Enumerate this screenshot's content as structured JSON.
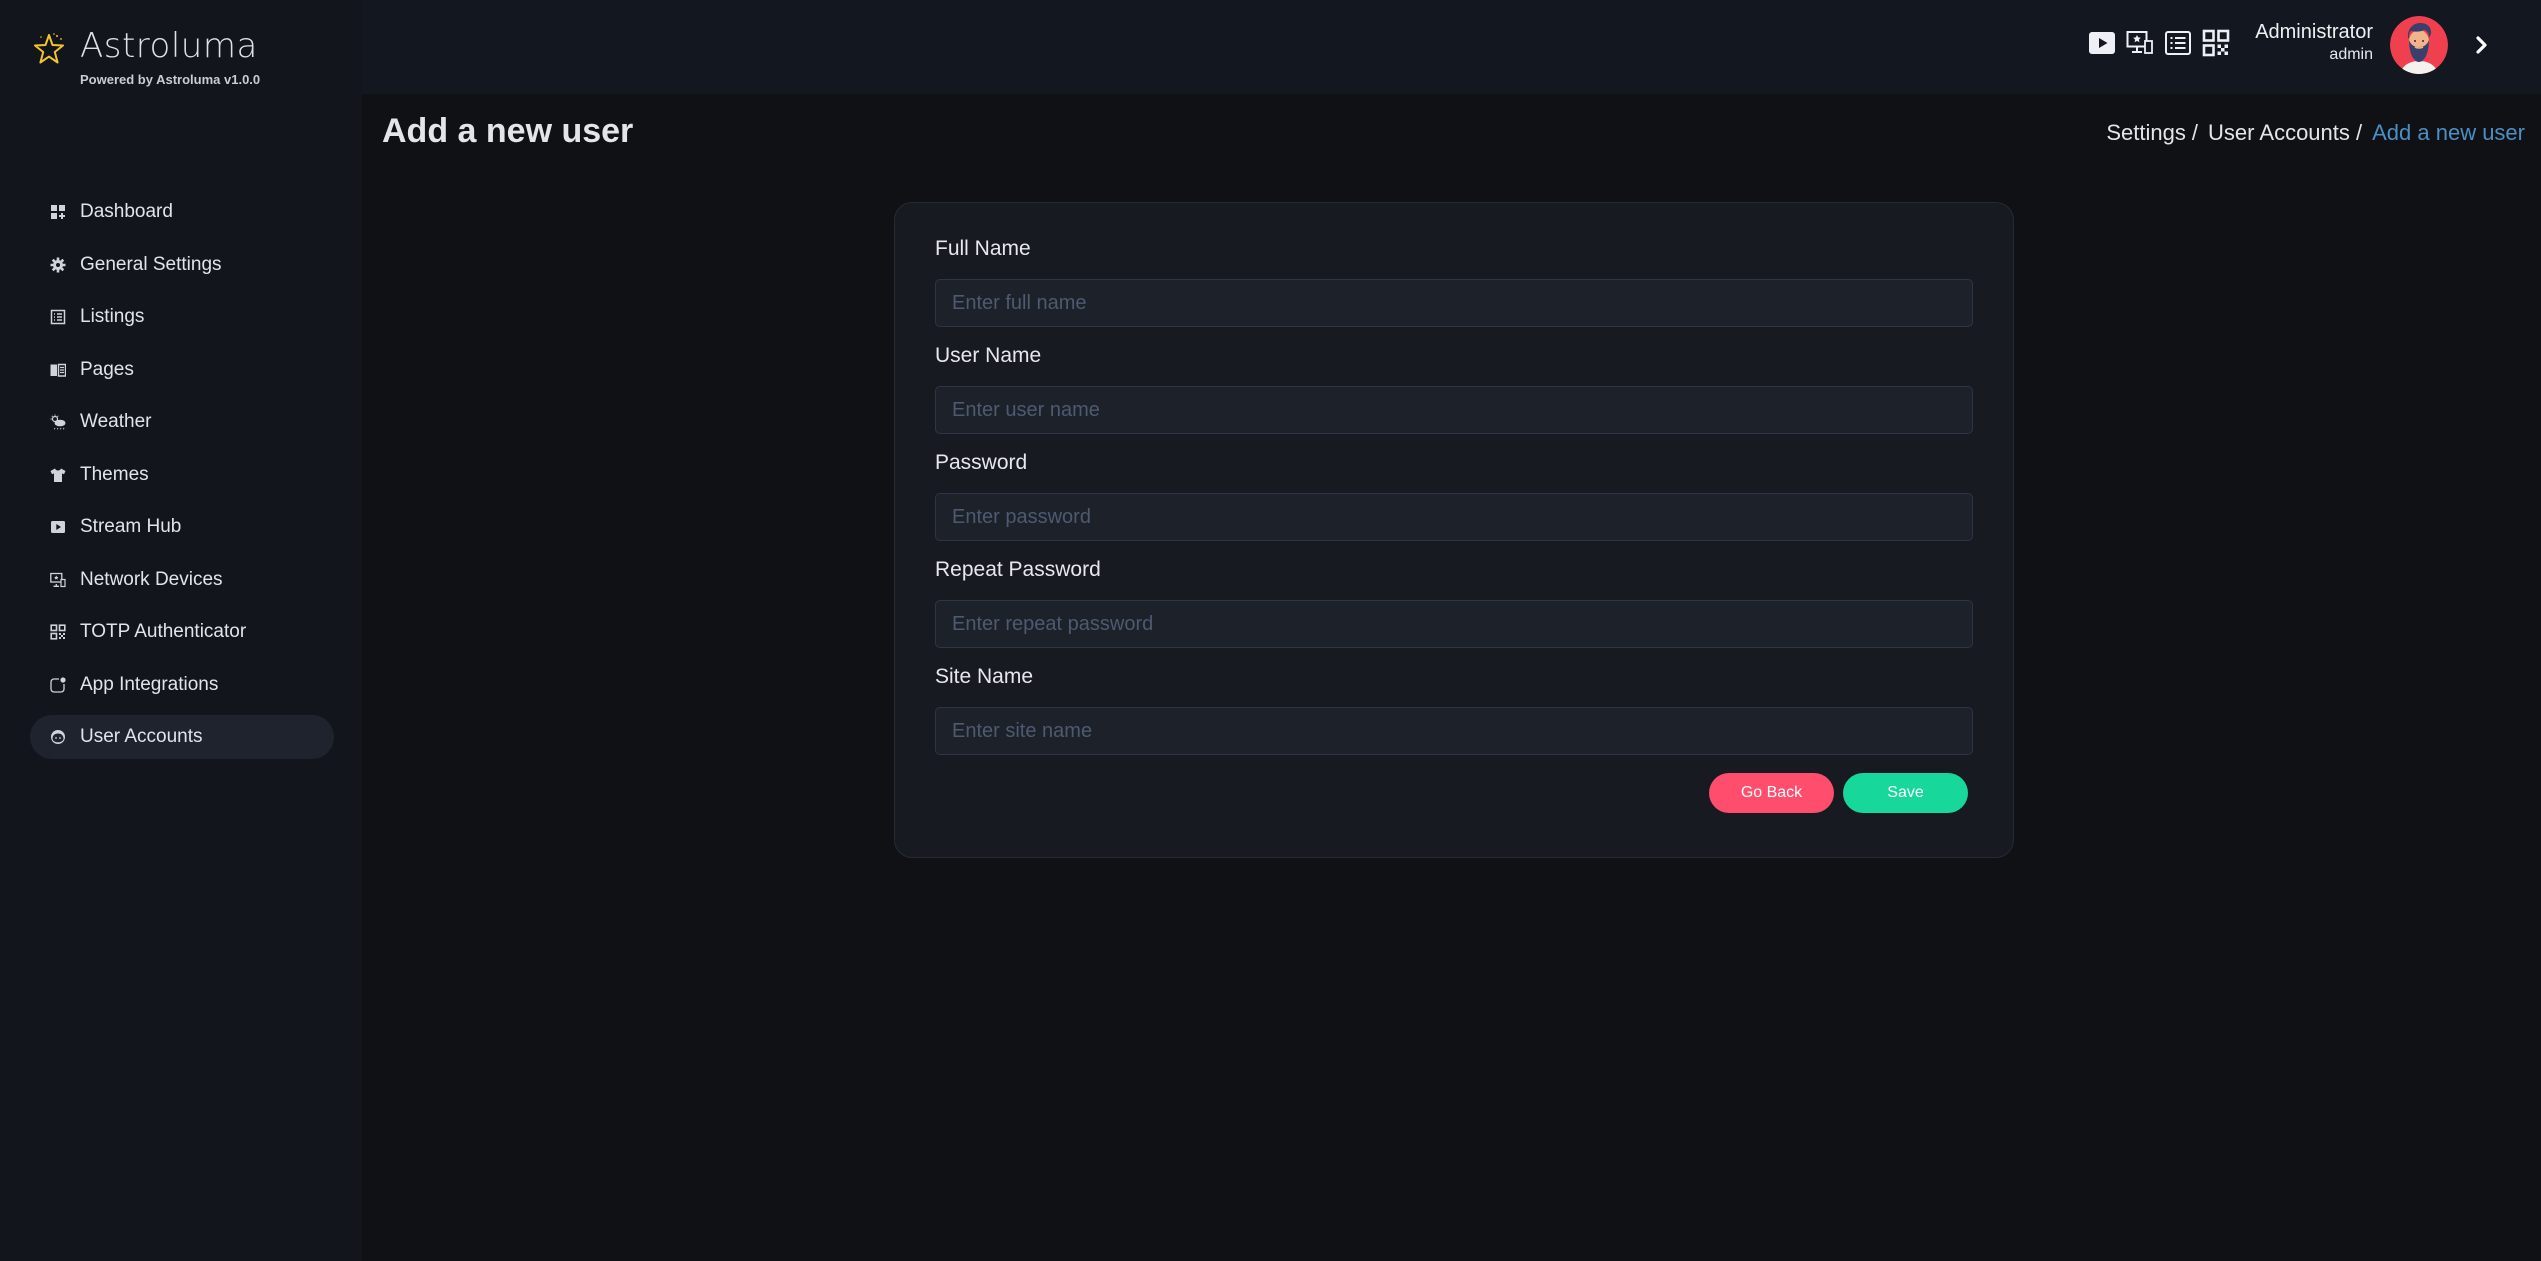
{
  "brand": {
    "title": "Astroluma",
    "subtitle": "Powered by Astroluma v1.0.0",
    "accent_color": "#f4c430"
  },
  "sidebar": {
    "items": [
      {
        "label": "Dashboard",
        "icon": "dashboard-icon",
        "active": false
      },
      {
        "label": "General Settings",
        "icon": "gear-icon",
        "active": false
      },
      {
        "label": "Listings",
        "icon": "list-icon",
        "active": false
      },
      {
        "label": "Pages",
        "icon": "book-icon",
        "active": false
      },
      {
        "label": "Weather",
        "icon": "weather-icon",
        "active": false
      },
      {
        "label": "Themes",
        "icon": "shirt-icon",
        "active": false
      },
      {
        "label": "Stream Hub",
        "icon": "play-icon",
        "active": false
      },
      {
        "label": "Network Devices",
        "icon": "devices-icon",
        "active": false
      },
      {
        "label": "TOTP Authenticator",
        "icon": "qr-icon",
        "active": false
      },
      {
        "label": "App Integrations",
        "icon": "integration-icon",
        "active": false
      },
      {
        "label": "User Accounts",
        "icon": "user-face-icon",
        "active": true
      }
    ]
  },
  "header": {
    "icons": [
      "play-icon",
      "devices-icon",
      "list-icon",
      "qr-icon"
    ],
    "user": {
      "name": "Administrator",
      "role": "admin"
    }
  },
  "page": {
    "title": "Add a new user",
    "breadcrumb": [
      {
        "label": "Settings /",
        "current": false
      },
      {
        "label": "User Accounts /",
        "current": false
      },
      {
        "label": "Add a new user",
        "current": true
      }
    ]
  },
  "form": {
    "fields": [
      {
        "label": "Full Name",
        "placeholder": "Enter full name",
        "value": "",
        "type": "text"
      },
      {
        "label": "User Name",
        "placeholder": "Enter user name",
        "value": "",
        "type": "text"
      },
      {
        "label": "Password",
        "placeholder": "Enter password",
        "value": "",
        "type": "password"
      },
      {
        "label": "Repeat Password",
        "placeholder": "Enter repeat password",
        "value": "",
        "type": "password"
      },
      {
        "label": "Site Name",
        "placeholder": "Enter site name",
        "value": "",
        "type": "text"
      }
    ],
    "go_back_label": "Go Back",
    "save_label": "Save",
    "colors": {
      "go_back": "#ff4d6d",
      "save": "#18d79a"
    }
  }
}
